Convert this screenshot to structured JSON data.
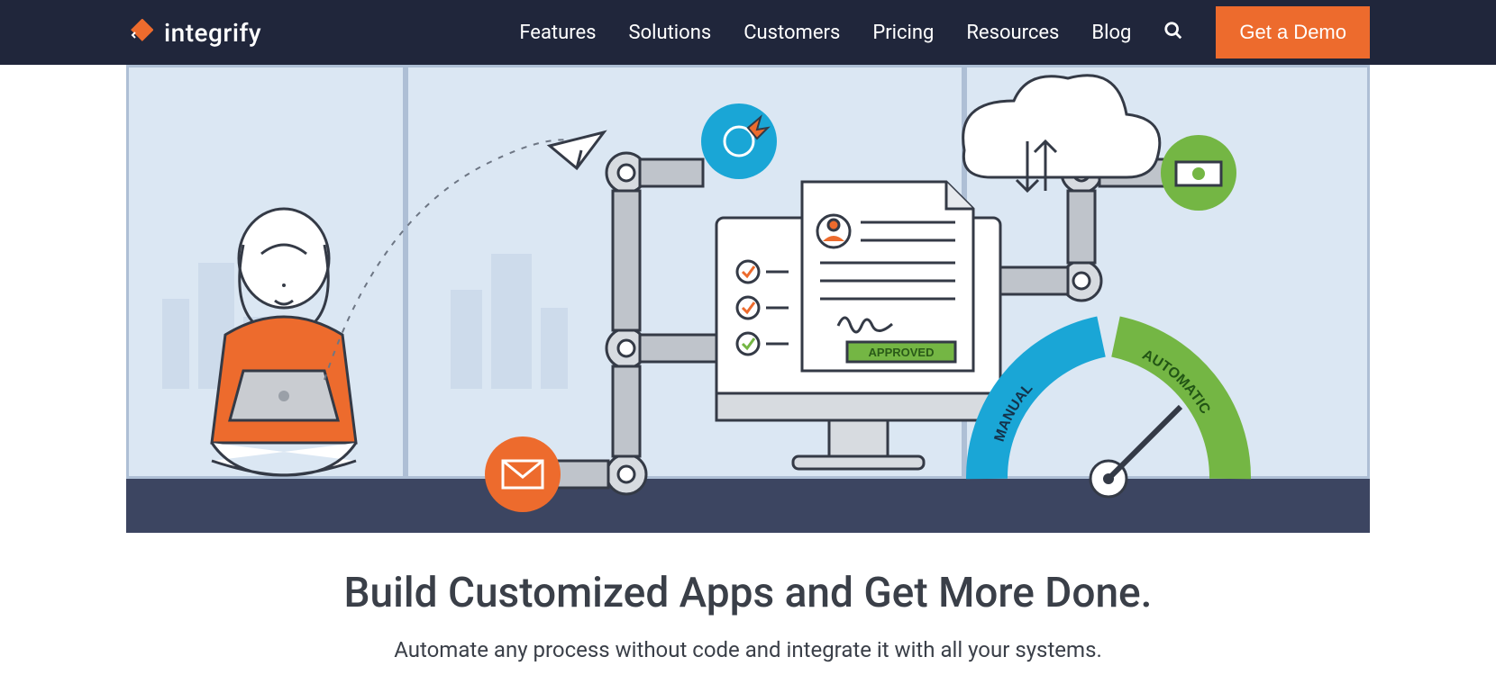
{
  "brand": {
    "name": "integrify"
  },
  "nav": {
    "items": [
      {
        "label": "Features"
      },
      {
        "label": "Solutions"
      },
      {
        "label": "Customers"
      },
      {
        "label": "Pricing"
      },
      {
        "label": "Resources"
      },
      {
        "label": "Blog"
      }
    ],
    "cta": "Get a Demo"
  },
  "hero": {
    "badge": "APPROVED",
    "gauge_left": "MANUAL",
    "gauge_right": "AUTOMATIC"
  },
  "headline": "Build Customized Apps and Get More Done.",
  "subhead": "Automate any process without code and integrate it with all your systems.",
  "colors": {
    "navy": "#20263b",
    "orange": "#ed6b2d",
    "blue": "#1aa6d6",
    "green": "#74b644",
    "sky": "#dbe7f3",
    "steel": "#3c4561"
  }
}
